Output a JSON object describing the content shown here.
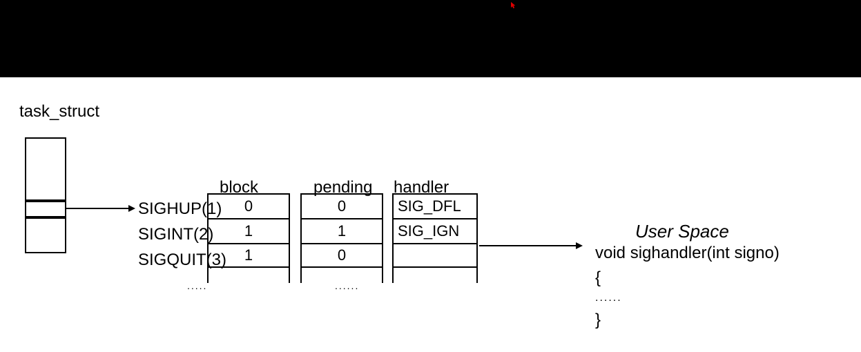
{
  "title": "task_struct",
  "signals": {
    "0": "SIGHUP(1)",
    "1": "SIGINT(2)",
    "2": "SIGQUIT(3)"
  },
  "columns": {
    "block": {
      "header": "block",
      "values": {
        "0": "0",
        "1": "1",
        "2": "1"
      },
      "dots": "....."
    },
    "pending": {
      "header": "pending",
      "values": {
        "0": "0",
        "1": "1",
        "2": "0"
      },
      "dots": "......"
    },
    "handler": {
      "header": "handler",
      "values": {
        "0": "SIG_DFL",
        "1": "SIG_IGN",
        "2": ""
      }
    }
  },
  "user_space": {
    "label": "User Space",
    "func": "void sighandler(int signo)",
    "brace_open": "{",
    "dots": "......",
    "brace_close": "}"
  }
}
